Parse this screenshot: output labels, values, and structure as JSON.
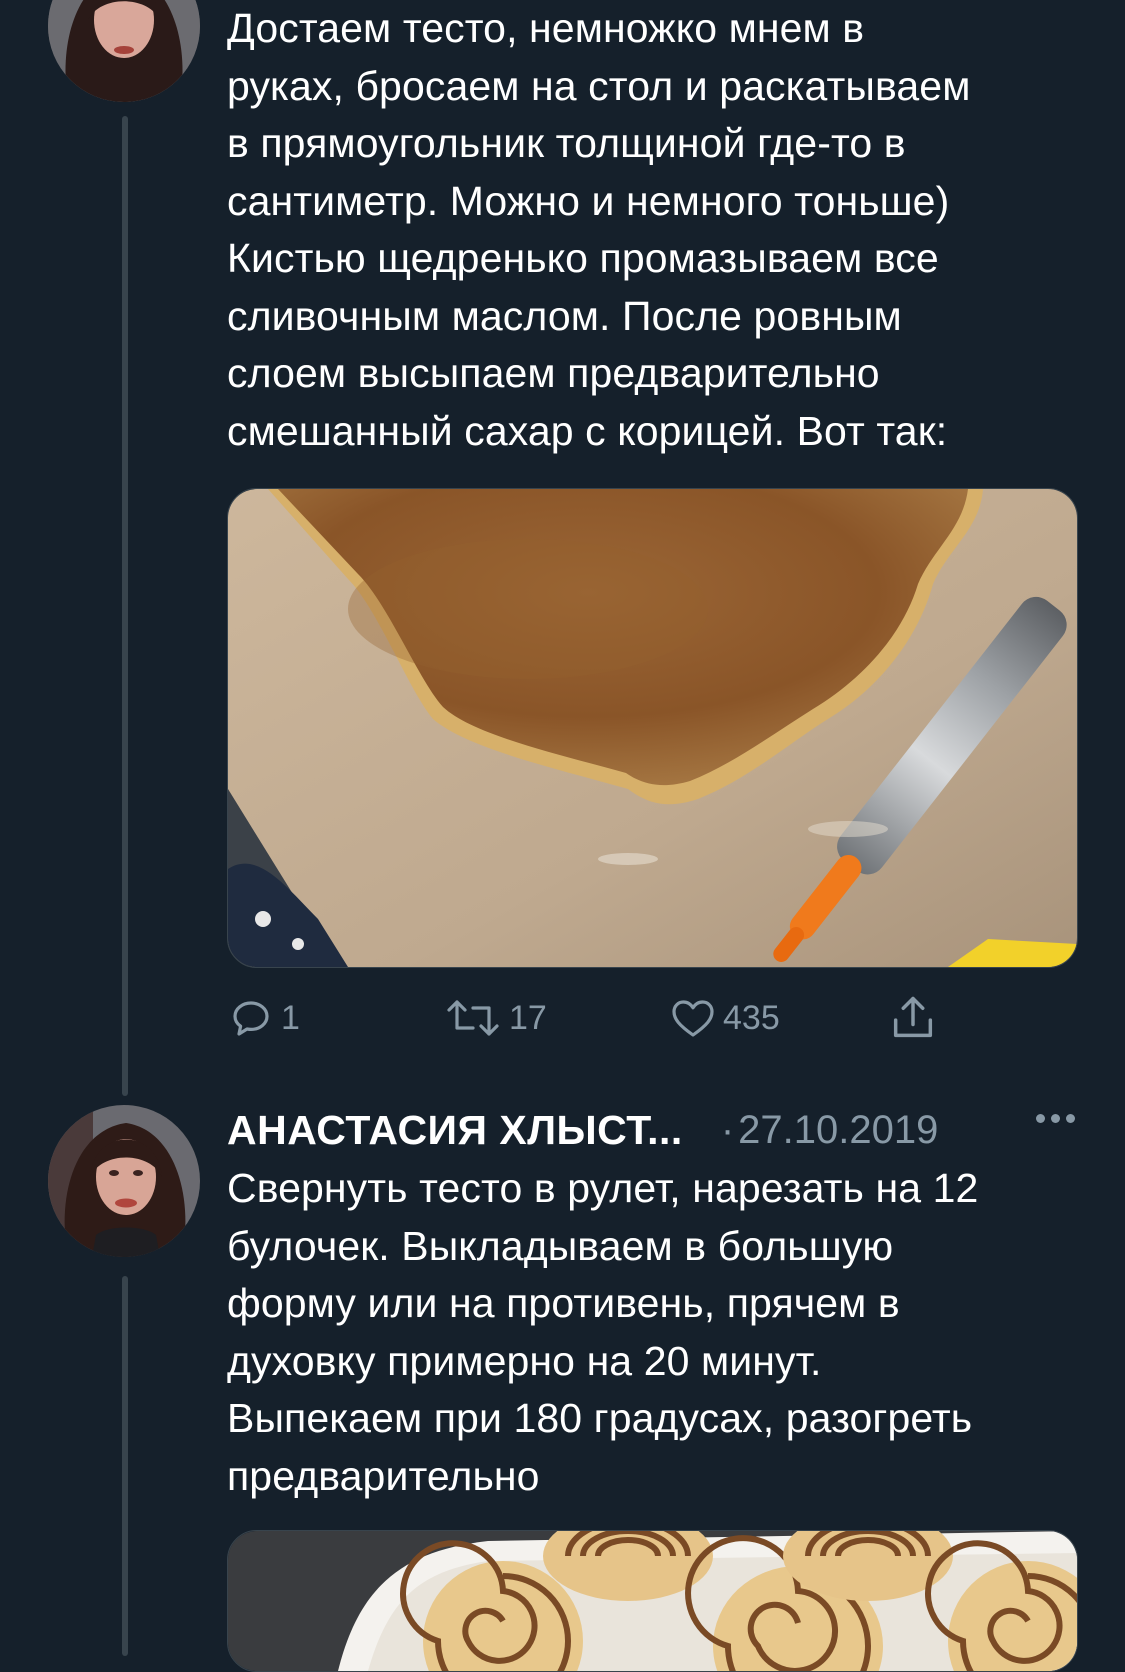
{
  "tweets": [
    {
      "text": "Достаем тесто, немножко мнем в\nруках, бросаем на стол и раскатываем\nв прямоугольник толщиной где-то в\nсантиметр. Можно и немного тоньше)\nКистью щедренько промазываем все\nсливочным маслом. После ровным\nслоем высыпаем предварительно\nсмешанный сахар с корицей. Вот так:",
      "actions": {
        "reply_count": "1",
        "retweet_count": "17",
        "like_count": "435"
      }
    },
    {
      "author": "АНАСТАСИЯ ХЛЫСТ...",
      "date": "27.10.2019",
      "text": "Свернуть тесто в рулет, нарезать на 12\nбулочек. Выкладываем в большую\nформу или на противень, прячем в\nдуховку примерно на 20 минут.\nВыпекаем при 180 градусах, разогреть\nпредварительно"
    }
  ],
  "icons": {
    "reply": "reply-icon",
    "retweet": "retweet-icon",
    "like": "heart-icon",
    "share": "share-icon",
    "more": "more-icon"
  },
  "colors": {
    "background": "#15202b",
    "text": "#ffffff",
    "secondary_text": "#8899a6",
    "thread_line": "#38444d"
  }
}
